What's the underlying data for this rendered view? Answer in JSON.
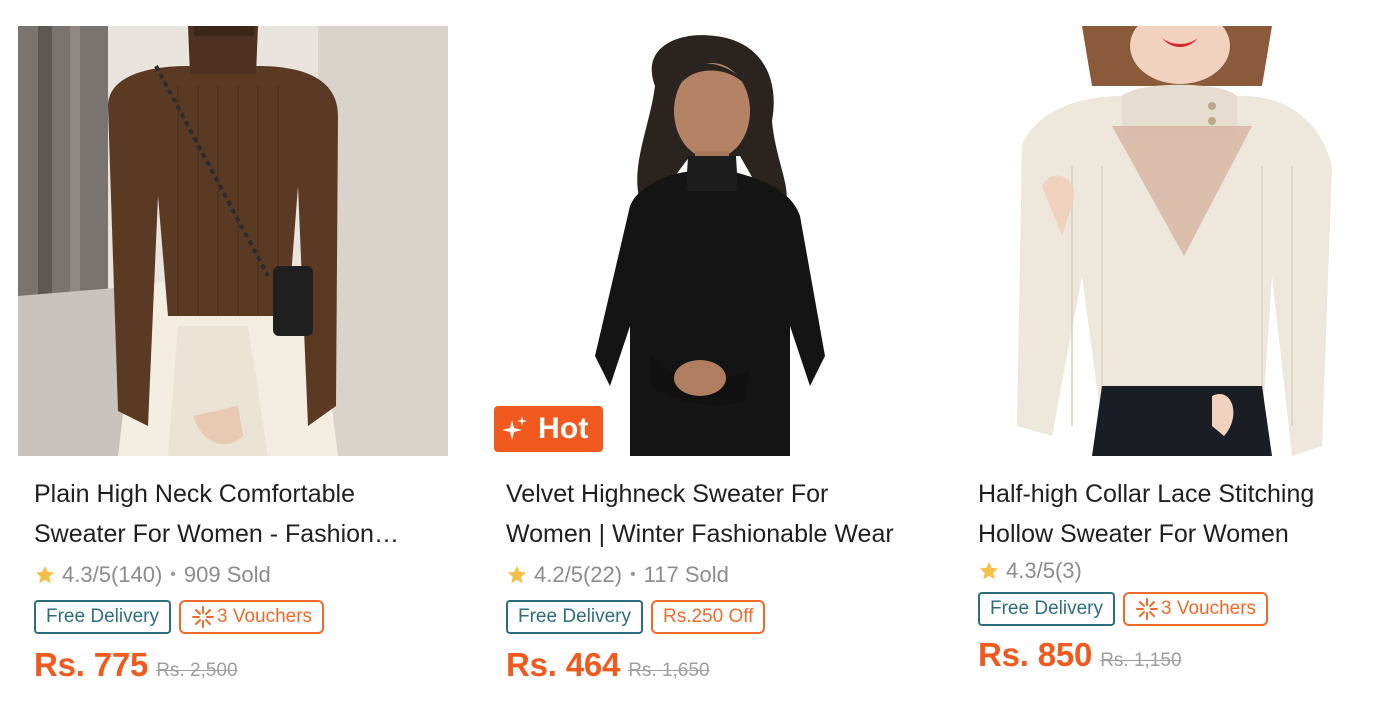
{
  "products": [
    {
      "title": "Plain High Neck Comfortable Sweater For Women - Fashion Tops",
      "rating": "4.3/5",
      "reviews": "(140)",
      "sold": "909 Sold",
      "free_delivery": "Free Delivery",
      "promo": "3 Vouchers",
      "price": "Rs. 775",
      "old_price": "Rs. 2,500",
      "image_icon": "brown-sweater-photo"
    },
    {
      "title": "Velvet Highneck Sweater For Women | Winter Fashionable Wear",
      "badge": "Hot",
      "rating": "4.2/5",
      "reviews": "(22)",
      "sold": "117 Sold",
      "free_delivery": "Free Delivery",
      "promo": "Rs.250 Off",
      "price": "Rs. 464",
      "old_price": "Rs. 1,650",
      "image_icon": "black-sweater-photo"
    },
    {
      "title": "Half-high Collar Lace Stitching Hollow Sweater For Women",
      "rating": "4.3/5",
      "reviews": "(3)",
      "free_delivery": "Free Delivery",
      "promo": "3 Vouchers",
      "price": "Rs. 850",
      "old_price": "Rs. 1,150",
      "image_icon": "cream-lace-sweater-photo"
    }
  ],
  "colors": {
    "accent": "#f05a1e",
    "free_delivery": "#2d6e7e",
    "star": "#f5c04a",
    "muted": "#8c8c8c"
  }
}
